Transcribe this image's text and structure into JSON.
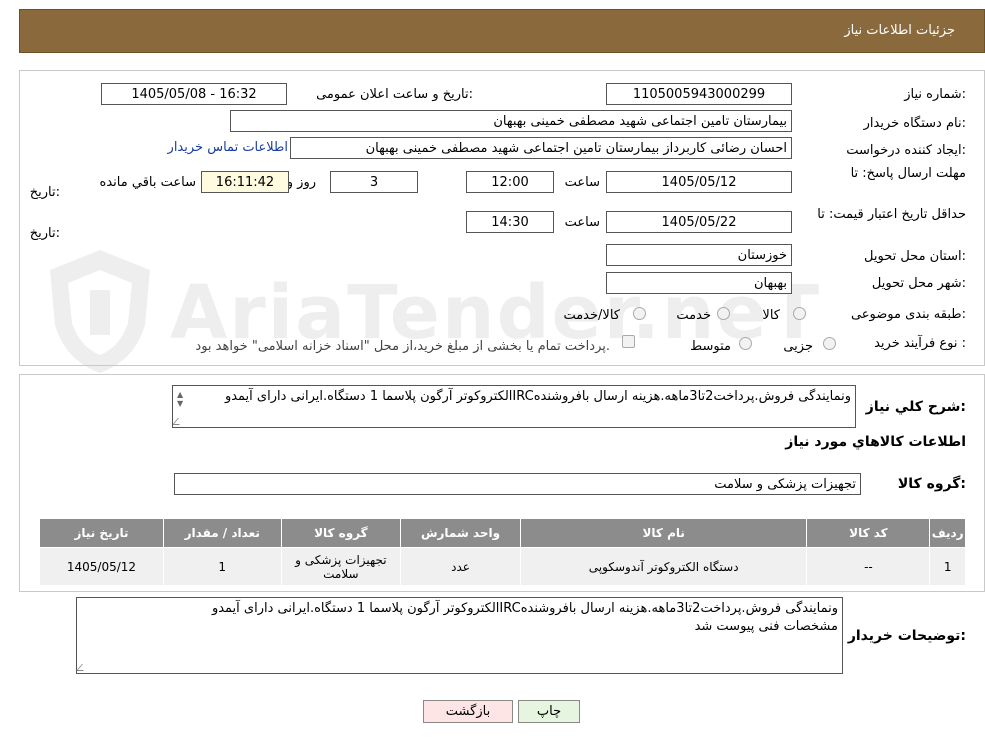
{
  "header": {
    "title": "جزئیات اطلاعات نیاز"
  },
  "form": {
    "need_number_label": "شماره نیاز:",
    "need_number": "1105005943000299",
    "announce_label": "تاریخ و ساعت اعلان عمومی:",
    "announce_value": "1405/05/08 - 16:32",
    "buyer_org_label": "نام دستگاه خریدار:",
    "buyer_org": "بیمارستان تامین اجتماعی شهید مصطفی خمینی بهبهان",
    "creator_label": "ایجاد کننده درخواست:",
    "creator": "احسان رضائی کاربرداز بیمارستان تامین اجتماعی شهید مصطفی خمینی بهبهان",
    "contact_link": "اطلاعات تماس خریدار",
    "deadline_label_1": "مهلت ارسال پاسخ: تا",
    "deadline_label_2": "تاریخ:",
    "deadline_date": "1405/05/12",
    "time_label": "ساعت",
    "deadline_time": "12:00",
    "days": "3",
    "days_label": "روز و",
    "remaining_time": "16:11:42",
    "remaining_label": "ساعت باقي مانده",
    "validity_label_1": "حداقل تاریخ اعتبار قیمت: تا",
    "validity_label_2": "تاریخ:",
    "validity_date": "1405/05/22",
    "validity_time": "14:30",
    "province_label": "استان محل تحویل:",
    "province": "خوزستان",
    "city_label": "شهر محل تحویل:",
    "city": "بهبهان",
    "category_label": "طبقه بندی موضوعی:",
    "category_options": [
      "کالا",
      "خدمت",
      "کالا/خدمت"
    ],
    "process_label": "نوع فرآیند خرید :",
    "process_options": [
      "جزیی",
      "متوسط"
    ],
    "payment_note": "پرداخت تمام یا بخشی از مبلغ خرید،از محل \"اسناد خزانه اسلامی\" خواهد بود."
  },
  "desc": {
    "label": "شرح کلي نیاز:",
    "text": "الکتروکوتر آرگون پلاسما 1 دستگاه.ایرانی دارای آیمدوIRCونمایندگی فروش.پرداخت2تا3ماهه.هزینه ارسال بافروشنده",
    "goods_info_title": "اطلاعات کالاهاي مورد نیاز",
    "group_label": "گروه کالا:",
    "group_value": "تجهیزات پزشکی و سلامت"
  },
  "table": {
    "headers": [
      "ردیف",
      "کد کالا",
      "نام کالا",
      "واحد شمارش",
      "گروه کالا",
      "تعداد / مقدار",
      "تاریخ نیاز"
    ],
    "rows": [
      [
        "1",
        "--",
        "دستگاه الکتروکوتر آندوسکوپی",
        "عدد",
        "تجهیزات پزشکی و سلامت",
        "1",
        "1405/05/12"
      ]
    ]
  },
  "buyer_notes": {
    "label": "توضیحات خریدار:",
    "line1": "الکتروکوتر آرگون پلاسما 1 دستگاه.ایرانی دارای آیمدوIRCونمایندگی فروش.پرداخت2تا3ماهه.هزینه ارسال بافروشنده",
    "line2": "مشخصات فنی پیوست شد"
  },
  "buttons": {
    "print": "چاپ",
    "back": "بازگشت"
  },
  "watermark": {
    "text": "AriaTender.neT"
  },
  "colors": {
    "header_bg": "#8a6a3c",
    "table_header": "#8c8c8c",
    "link": "#1a3ea0",
    "back_btn": "#fde5e5",
    "print_btn": "#e5f5e0"
  }
}
